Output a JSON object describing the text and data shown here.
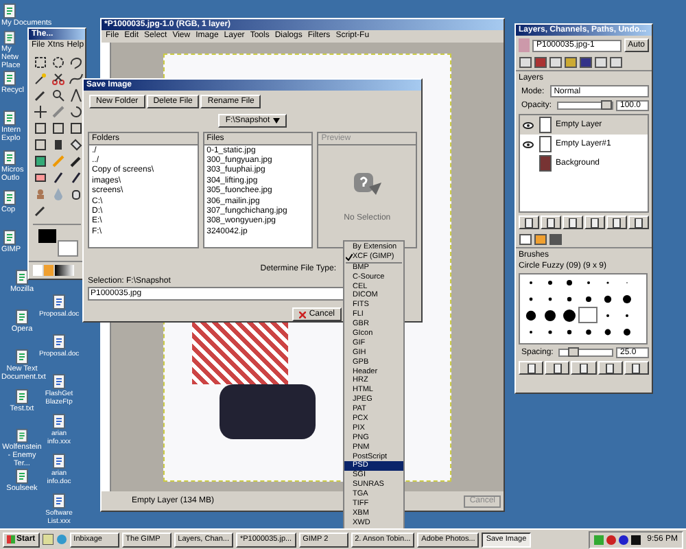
{
  "desktop_icons": {
    "column_1": [
      "My Documents",
      "My Netw Place",
      "Recycl",
      "Intern Explo",
      "Micros Outlo",
      "Cop",
      "GIMP",
      "Mozilla",
      "Opera",
      "New Text Document.txt",
      "Test.txt",
      "Wolfenstein - Enemy Ter...",
      "Soulseek"
    ],
    "column_2": [
      "Proposal.doc",
      "Proposal.doc",
      "FlashGet BlazeFtp",
      "arian info.xxx",
      "arian info.doc",
      "Software List.xxx"
    ]
  },
  "image_window": {
    "title": "*P1000035.jpg-1.0 (RGB, 1 layer)",
    "menu": [
      "File",
      "Edit",
      "Select",
      "View",
      "Image",
      "Layer",
      "Tools",
      "Dialogs",
      "Filters",
      "Script-Fu"
    ],
    "status": "Empty Layer (134 MB)",
    "cancel": "Cancel"
  },
  "toolbox": {
    "title": "The...",
    "menu": [
      "File",
      "Xtns",
      "Help"
    ]
  },
  "save_dialog": {
    "title": "Save Image",
    "buttons": [
      "New Folder",
      "Delete File",
      "Rename File"
    ],
    "location": "F:\\Snapshot",
    "folders_header": "Folders",
    "folders": [
      "./",
      "../",
      "Copy of screens\\",
      "images\\",
      "screens\\",
      "C:\\",
      "D:\\",
      "E:\\",
      "F:\\"
    ],
    "files_header": "Files",
    "files": [
      "0-1_static.jpg",
      "300_fungyuan.jpg",
      "303_fuuphai.jpg",
      "304_lifting.jpg",
      "305_fuonchee.jpg",
      "306_mailin.jpg",
      "307_fungchichang.jpg",
      "308_wongyuen.jpg",
      "3240042.jp"
    ],
    "preview_header": "Preview",
    "preview_text": "No Selection",
    "file_type_label": "Determine File Type:",
    "selection_label": "Selection: F:\\Snapshot",
    "filename": "P1000035.jpg",
    "cancel": "Cancel"
  },
  "file_type_menu": {
    "top": [
      {
        "label": "By Extension",
        "checked": false
      },
      {
        "label": "XCF (GIMP)",
        "checked": true
      }
    ],
    "types": [
      {
        "label": "BMP",
        "selected": false
      },
      {
        "label": "C-Source",
        "selected": false
      },
      {
        "label": "CEL",
        "selected": false
      },
      {
        "label": "DICOM",
        "selected": false
      },
      {
        "label": "FITS",
        "selected": false
      },
      {
        "label": "FLI",
        "selected": false
      },
      {
        "label": "GBR",
        "selected": false
      },
      {
        "label": "GIcon",
        "selected": false
      },
      {
        "label": "GIF",
        "selected": false
      },
      {
        "label": "GIH",
        "selected": false
      },
      {
        "label": "GPB",
        "selected": false
      },
      {
        "label": "Header",
        "selected": false
      },
      {
        "label": "HRZ",
        "selected": false
      },
      {
        "label": "HTML",
        "selected": false
      },
      {
        "label": "JPEG",
        "selected": false
      },
      {
        "label": "PAT",
        "selected": false
      },
      {
        "label": "PCX",
        "selected": false
      },
      {
        "label": "PIX",
        "selected": false
      },
      {
        "label": "PNG",
        "selected": false
      },
      {
        "label": "PNM",
        "selected": false
      },
      {
        "label": "PostScript",
        "selected": false
      },
      {
        "label": "PSD",
        "selected": true
      },
      {
        "label": "SGI",
        "selected": false
      },
      {
        "label": "SUNRAS",
        "selected": false
      },
      {
        "label": "TGA",
        "selected": false
      },
      {
        "label": "TIFF",
        "selected": false
      },
      {
        "label": "XBM",
        "selected": false
      },
      {
        "label": "XWD",
        "selected": false
      }
    ]
  },
  "dock": {
    "title": "Layers, Channels, Paths, Undo...",
    "image": "P1000035.jpg-1",
    "auto": "Auto",
    "layers_label": "Layers",
    "mode_label": "Mode:",
    "mode": "Normal",
    "opacity_label": "Opacity:",
    "opacity": {
      "level": 1,
      "reading": "100.0"
    },
    "layers": [
      {
        "name": "Empty Layer",
        "visible": true,
        "selected": true
      },
      {
        "name": "Empty Layer#1",
        "visible": true,
        "selected": false
      },
      {
        "name": "Background",
        "visible": false,
        "selected": false
      }
    ],
    "brushes_label": "Brushes",
    "brush_name": "Circle Fuzzy (09) (9 x 9)",
    "spacing_label": "Spacing:",
    "spacing": {
      "level": 0.2,
      "reading": "25.0"
    }
  },
  "taskbar": {
    "start": "Start",
    "tasks": [
      {
        "label": "Inbixage",
        "selected": false
      },
      {
        "label": "The GIMP",
        "selected": false
      },
      {
        "label": "Layers, Chan...",
        "selected": false
      },
      {
        "label": "*P1000035.jp...",
        "selected": false
      },
      {
        "label": "GIMP 2",
        "selected": false
      },
      {
        "label": "2. Anson Tobin...",
        "selected": false
      },
      {
        "label": "Adobe Photos...",
        "selected": false
      },
      {
        "label": "Save Image",
        "selected": true
      }
    ],
    "clock": "9:56 PM"
  }
}
